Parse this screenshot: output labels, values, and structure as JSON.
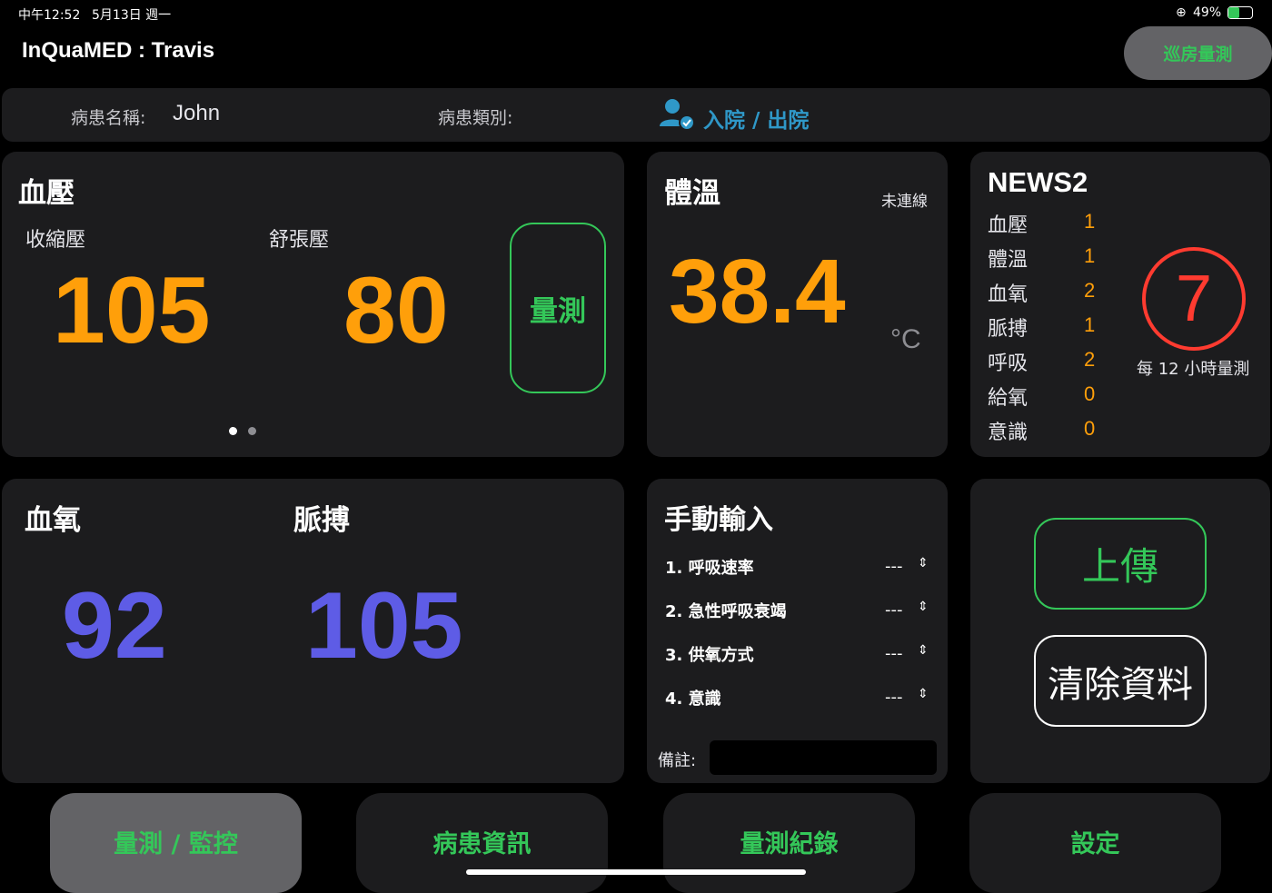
{
  "status_bar": {
    "time": "中午12:52",
    "date": "5月13日 週一",
    "battery": "49%"
  },
  "header": {
    "title": "InQuaMED : Travis",
    "round_button": "巡房量測"
  },
  "patient": {
    "name_label": "病患名稱:",
    "name": "John",
    "type_label": "病患類別:",
    "type_link": "入院 / 出院"
  },
  "blood_pressure": {
    "title": "血壓",
    "systolic_label": "收縮壓",
    "systolic": "105",
    "diastolic_label": "舒張壓",
    "diastolic": "80",
    "measure_button": "量測"
  },
  "temperature": {
    "title": "體溫",
    "status": "未連線",
    "value": "38.4",
    "unit": "°C"
  },
  "news2": {
    "title": "NEWS2",
    "rows": [
      {
        "label": "血壓",
        "score": "1"
      },
      {
        "label": "體溫",
        "score": "1"
      },
      {
        "label": "血氧",
        "score": "2"
      },
      {
        "label": "脈搏",
        "score": "1"
      },
      {
        "label": "呼吸",
        "score": "2"
      },
      {
        "label": "給氧",
        "score": "0"
      },
      {
        "label": "意識",
        "score": "0"
      }
    ],
    "total": "7",
    "frequency": "每 12 小時量測"
  },
  "spo2": {
    "title": "血氧",
    "value": "92"
  },
  "pulse": {
    "title": "脈搏",
    "value": "105"
  },
  "manual_input": {
    "title": "手動輸入",
    "items": [
      {
        "label": "1. 呼吸速率",
        "value": "---"
      },
      {
        "label": "2. 急性呼吸衰竭",
        "value": "---"
      },
      {
        "label": "3. 供氧方式",
        "value": "---"
      },
      {
        "label": "4. 意識",
        "value": "---"
      }
    ],
    "note_label": "備註:",
    "note_value": ""
  },
  "actions": {
    "upload": "上傳",
    "clear": "清除資料"
  },
  "tabs": [
    {
      "label": "量測 / 監控"
    },
    {
      "label": "病患資訊"
    },
    {
      "label": "量測紀錄"
    },
    {
      "label": "設定"
    }
  ],
  "colors": {
    "accent_green": "#34c759",
    "orange": "#ff9f0a",
    "purple": "#5e5ce6",
    "news_red": "#ff3b30",
    "link_blue": "#2f98c8"
  }
}
